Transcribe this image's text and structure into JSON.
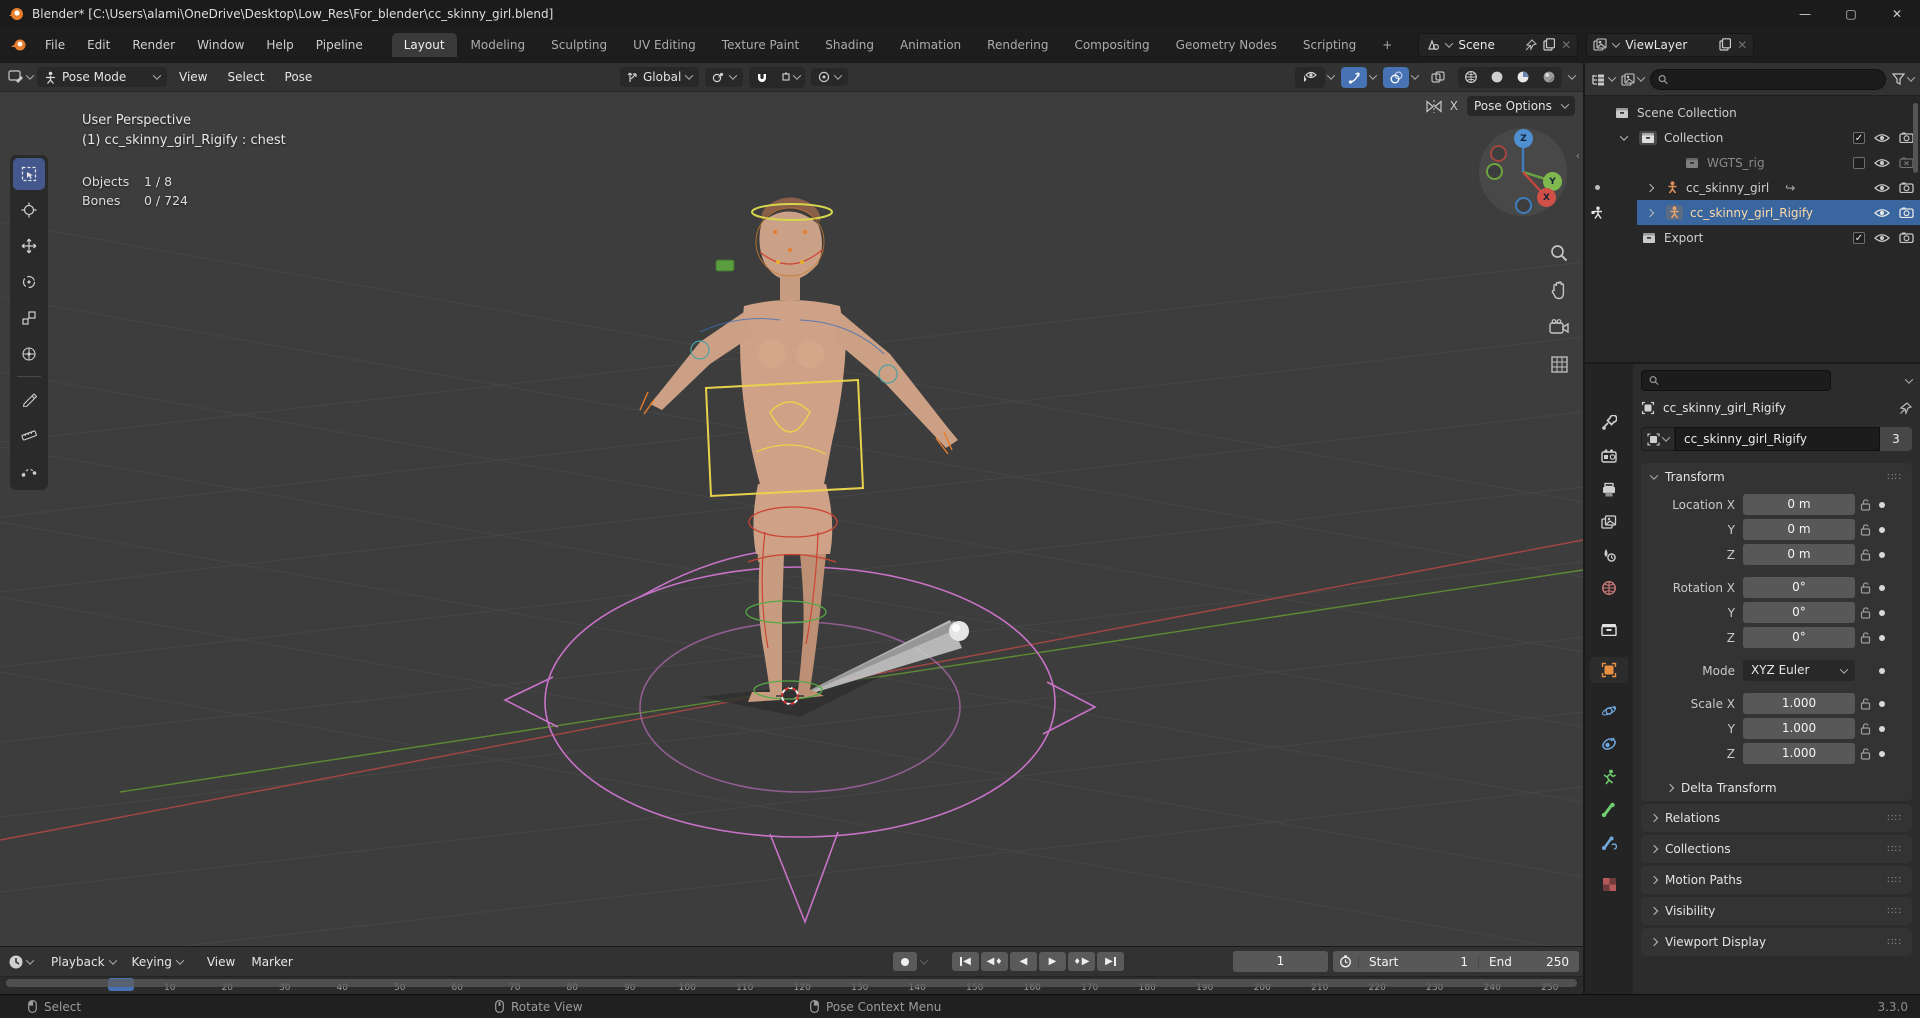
{
  "window": {
    "title": "Blender* [C:\\Users\\alami\\OneDrive\\Desktop\\Low_Res\\For_blender\\cc_skinny_girl.blend]",
    "controls": {
      "minimize": "—",
      "maximize": "▢",
      "close": "✕"
    }
  },
  "topbar": {
    "menus": [
      "File",
      "Edit",
      "Render",
      "Window",
      "Help",
      "Pipeline"
    ],
    "workspaces": [
      "Layout",
      "Modeling",
      "Sculpting",
      "UV Editing",
      "Texture Paint",
      "Shading",
      "Animation",
      "Rendering",
      "Compositing",
      "Geometry Nodes",
      "Scripting"
    ],
    "add_workspace": "+",
    "scene": {
      "label": "Scene"
    },
    "view_layer": {
      "label": "ViewLayer"
    }
  },
  "viewport": {
    "header": {
      "mode": "Pose Mode",
      "menus": [
        "View",
        "Select",
        "Pose"
      ],
      "orientation": "Global"
    },
    "overlay": {
      "perspective": "User Perspective",
      "active_item": "(1) cc_skinny_girl_Rigify : chest",
      "stats": [
        {
          "label": "Objects",
          "value": "1 / 8"
        },
        {
          "label": "Bones",
          "value": "0 / 724"
        }
      ]
    },
    "pose_options_label": "Pose Options",
    "mirror_x_label": "X",
    "gizmo_axes": {
      "z": "Z",
      "y": "Y",
      "x": "X"
    }
  },
  "outliner": {
    "rows": [
      {
        "label": "Scene Collection"
      },
      {
        "label": "Collection"
      },
      {
        "label": "WGTS_rig"
      },
      {
        "label": "cc_skinny_girl"
      },
      {
        "label": "cc_skinny_girl_Rigify"
      },
      {
        "label": "Export"
      }
    ]
  },
  "properties": {
    "breadcrumb": "cc_skinny_girl_Rigify",
    "name_field": "cc_skinny_girl_Rigify",
    "users_count": "3",
    "transform": {
      "title": "Transform",
      "rows": [
        {
          "label": "Location X",
          "value": "0 m"
        },
        {
          "label": "Y",
          "value": "0 m"
        },
        {
          "label": "Z",
          "value": "0 m"
        },
        {
          "label": "Rotation X",
          "value": "0°"
        },
        {
          "label": "Y",
          "value": "0°"
        },
        {
          "label": "Z",
          "value": "0°"
        },
        {
          "label": "Mode",
          "value": "XYZ Euler"
        },
        {
          "label": "Scale X",
          "value": "1.000"
        },
        {
          "label": "Y",
          "value": "1.000"
        },
        {
          "label": "Z",
          "value": "1.000"
        }
      ],
      "delta_label": "Delta Transform"
    },
    "panels": [
      "Relations",
      "Collections",
      "Motion Paths",
      "Visibility",
      "Viewport Display"
    ]
  },
  "timeline": {
    "menus": [
      "Playback",
      "Keying",
      "View",
      "Marker"
    ],
    "current_frame": "1",
    "start_label": "Start",
    "start_value": "1",
    "end_label": "End",
    "end_value": "250",
    "ruler": {
      "ticks": [
        10,
        20,
        30,
        40,
        50,
        60,
        70,
        80,
        90,
        100,
        110,
        120,
        130,
        140,
        150,
        160,
        170,
        180,
        190,
        200,
        210,
        220,
        230,
        240,
        250
      ]
    }
  },
  "statusbar": {
    "hints": [
      {
        "label": "Select"
      },
      {
        "label": "Rotate View"
      },
      {
        "label": "Pose Context Menu"
      }
    ],
    "version": "3.3.0"
  }
}
